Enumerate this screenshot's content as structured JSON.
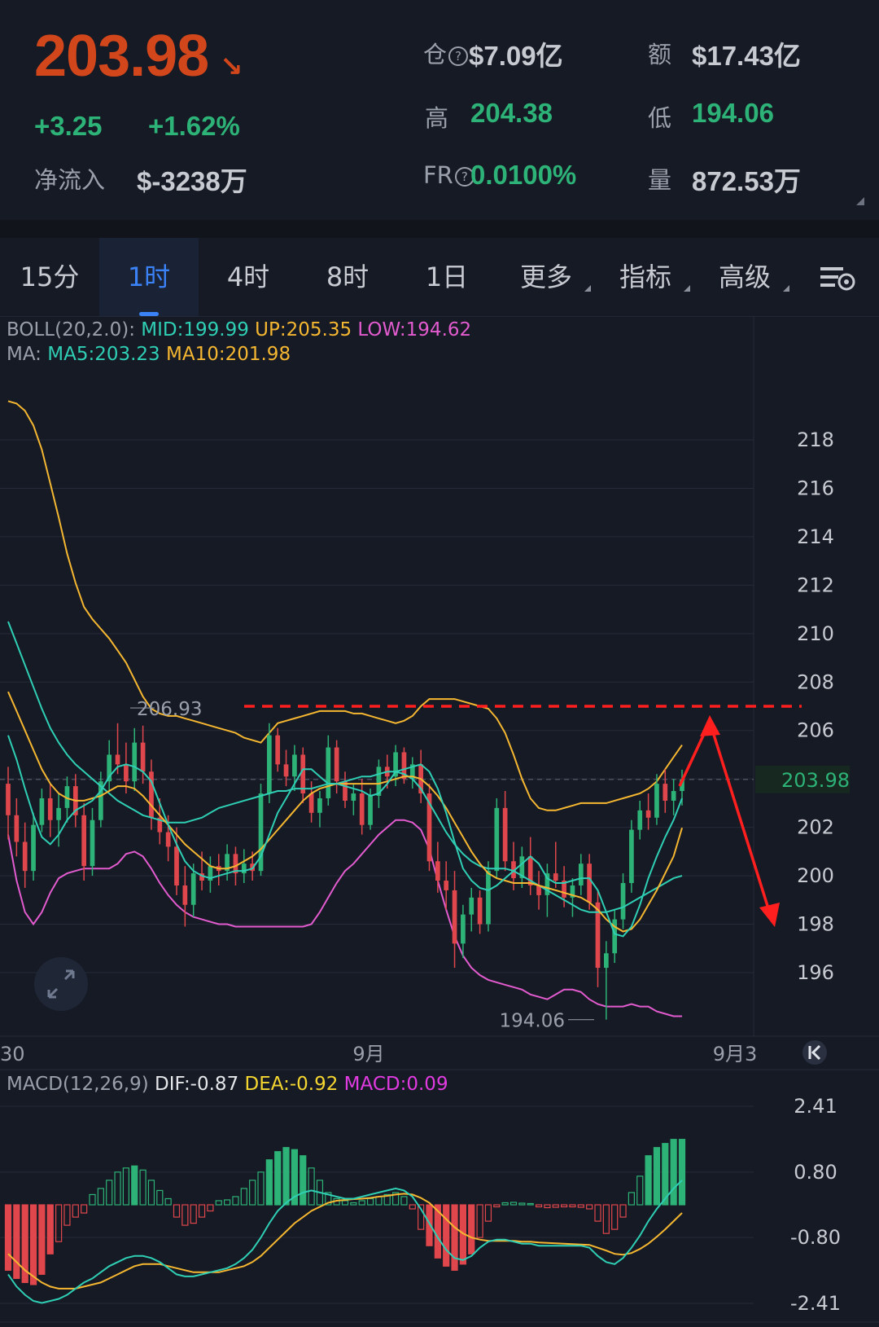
{
  "header": {
    "price": "203.98",
    "price_arrow": "↘",
    "change_abs": "+3.25",
    "change_pct": "+1.62%",
    "netflow_label": "净流入",
    "netflow_value": "$-3238万",
    "oi_label": "仓",
    "oi_value": "$7.09亿",
    "high_label": "高",
    "high_value": "204.38",
    "fr_label": "FR",
    "fr_value": "0.0100%",
    "turnover_label": "额",
    "turnover_value": "$17.43亿",
    "low_label": "低",
    "low_value": "194.06",
    "volume_label": "量",
    "volume_value": "872.53万"
  },
  "tabs": [
    {
      "label": "15分"
    },
    {
      "label": "1时"
    },
    {
      "label": "4时"
    },
    {
      "label": "8时"
    },
    {
      "label": "1日"
    },
    {
      "label": "更多"
    },
    {
      "label": "指标"
    },
    {
      "label": "高级"
    }
  ],
  "active_tab": "1时",
  "indicators": {
    "boll_prefix": "BOLL(20,2.0): ",
    "boll_mid": "MID:199.99",
    "boll_up": "UP:205.35",
    "boll_low": "LOW:194.62",
    "ma_prefix": "MA: ",
    "ma5": "MA5:203.23",
    "ma10": "MA10:201.98",
    "macd_prefix": "MACD(12,26,9) ",
    "dif": "DIF:-0.87",
    "dea": "DEA:-0.92",
    "macd": "MACD:0.09"
  },
  "colors": {
    "up": "#2db277",
    "down": "#e0474c",
    "mid": "#2fcfb5",
    "upper": "#f5b731",
    "lower": "#e25bcf",
    "price": "#d2461b",
    "annotation": "#ff1f1f"
  },
  "chart_data": [
    {
      "type": "candlestick",
      "title": "",
      "x_labels": [
        "30",
        "9月",
        "9月3"
      ],
      "y_ticks": [
        218,
        216,
        214,
        212,
        210,
        208,
        206,
        204,
        202,
        200,
        198,
        196
      ],
      "ylim": [
        194.06,
        220.5
      ],
      "current_price_label": "203.98",
      "high_annotation": "206.93",
      "low_annotation": "194.06",
      "ohlc": [
        [
          203.8,
          204.5,
          201.5,
          202.5
        ],
        [
          202.5,
          203.2,
          200.8,
          201.4
        ],
        [
          201.4,
          202.2,
          199.5,
          200.2
        ],
        [
          200.2,
          202.6,
          199.8,
          202.1
        ],
        [
          202.1,
          203.6,
          201.8,
          203.2
        ],
        [
          203.2,
          203.8,
          201.6,
          202.3
        ],
        [
          202.3,
          203.4,
          201.2,
          202.8
        ],
        [
          202.8,
          204.1,
          202.2,
          203.7
        ],
        [
          203.7,
          204.2,
          202.0,
          202.5
        ],
        [
          202.5,
          203.0,
          199.8,
          200.4
        ],
        [
          200.4,
          202.8,
          200.0,
          202.3
        ],
        [
          202.3,
          204.3,
          202.0,
          203.9
        ],
        [
          203.9,
          205.6,
          203.5,
          205.0
        ],
        [
          205.0,
          206.3,
          204.2,
          204.6
        ],
        [
          204.6,
          205.5,
          203.4,
          203.9
        ],
        [
          203.9,
          206.1,
          203.5,
          205.5
        ],
        [
          205.5,
          206.2,
          203.8,
          204.3
        ],
        [
          204.3,
          204.8,
          201.9,
          202.4
        ],
        [
          202.4,
          203.2,
          201.3,
          201.8
        ],
        [
          201.8,
          202.5,
          200.6,
          201.2
        ],
        [
          201.2,
          202.0,
          199.2,
          199.6
        ],
        [
          199.6,
          200.4,
          197.9,
          198.8
        ],
        [
          198.8,
          200.5,
          198.3,
          200.1
        ],
        [
          200.1,
          201.0,
          199.4,
          199.8
        ],
        [
          199.8,
          200.8,
          199.3,
          200.4
        ],
        [
          200.4,
          200.9,
          199.6,
          200.2
        ],
        [
          200.2,
          201.3,
          199.8,
          200.9
        ],
        [
          200.9,
          201.2,
          199.6,
          200.1
        ],
        [
          200.1,
          201.1,
          199.7,
          200.5
        ],
        [
          200.5,
          201.0,
          199.8,
          200.2
        ],
        [
          200.2,
          203.8,
          200.0,
          203.4
        ],
        [
          203.4,
          206.3,
          203.0,
          205.8
        ],
        [
          205.8,
          206.1,
          204.3,
          204.6
        ],
        [
          204.6,
          205.2,
          203.7,
          204.1
        ],
        [
          204.1,
          205.4,
          203.5,
          205.0
        ],
        [
          205.0,
          205.3,
          203.0,
          203.4
        ],
        [
          203.4,
          203.9,
          202.2,
          202.6
        ],
        [
          202.6,
          203.5,
          202.0,
          203.2
        ],
        [
          203.2,
          205.8,
          202.9,
          205.3
        ],
        [
          205.3,
          205.6,
          203.4,
          203.9
        ],
        [
          203.9,
          204.3,
          202.8,
          203.1
        ],
        [
          203.1,
          203.8,
          202.5,
          203.4
        ],
        [
          203.4,
          204.0,
          201.7,
          202.1
        ],
        [
          202.1,
          203.6,
          201.9,
          203.3
        ],
        [
          203.3,
          204.8,
          202.8,
          204.5
        ],
        [
          204.5,
          205.0,
          203.6,
          204.1
        ],
        [
          204.1,
          205.4,
          203.7,
          205.1
        ],
        [
          205.1,
          205.3,
          203.8,
          204.0
        ],
        [
          204.0,
          204.9,
          203.6,
          204.6
        ],
        [
          204.6,
          205.2,
          203.0,
          203.4
        ],
        [
          203.4,
          203.8,
          200.2,
          200.6
        ],
        [
          200.6,
          201.4,
          199.3,
          199.8
        ],
        [
          199.8,
          200.6,
          198.6,
          199.4
        ],
        [
          199.4,
          200.2,
          196.2,
          197.2
        ],
        [
          197.2,
          198.8,
          196.6,
          198.4
        ],
        [
          198.4,
          199.5,
          197.7,
          199.1
        ],
        [
          199.1,
          199.4,
          197.6,
          198.0
        ],
        [
          198.0,
          200.6,
          197.7,
          200.2
        ],
        [
          200.2,
          203.2,
          199.9,
          202.8
        ],
        [
          202.8,
          203.5,
          200.2,
          200.6
        ],
        [
          200.6,
          201.4,
          199.4,
          199.9
        ],
        [
          199.9,
          201.2,
          199.5,
          200.8
        ],
        [
          200.8,
          201.6,
          199.2,
          199.6
        ],
        [
          199.6,
          200.2,
          198.6,
          199.2
        ],
        [
          199.2,
          200.5,
          198.3,
          200.1
        ],
        [
          200.1,
          201.4,
          199.5,
          199.8
        ],
        [
          199.8,
          200.4,
          198.7,
          199.1
        ],
        [
          199.1,
          199.9,
          198.3,
          199.6
        ],
        [
          199.6,
          200.9,
          199.2,
          200.5
        ],
        [
          200.5,
          200.9,
          198.6,
          198.9
        ],
        [
          198.9,
          199.4,
          195.4,
          196.2
        ],
        [
          196.2,
          197.3,
          194.06,
          196.8
        ],
        [
          196.8,
          198.6,
          196.4,
          198.2
        ],
        [
          198.2,
          200.1,
          197.8,
          199.7
        ],
        [
          199.7,
          202.3,
          199.3,
          201.9
        ],
        [
          201.9,
          203.1,
          201.5,
          202.7
        ],
        [
          202.7,
          203.4,
          201.9,
          202.4
        ],
        [
          202.4,
          204.2,
          202.1,
          203.8
        ],
        [
          203.8,
          204.4,
          202.6,
          203.1
        ],
        [
          203.1,
          204.0,
          202.5,
          203.5
        ],
        [
          203.5,
          204.38,
          202.9,
          203.98
        ]
      ],
      "boll_upper": [
        219.6,
        219.5,
        219.2,
        218.6,
        217.6,
        216.2,
        214.8,
        213.3,
        212.1,
        211.1,
        210.6,
        210.2,
        209.8,
        209.3,
        208.8,
        208.1,
        207.4,
        206.9,
        206.7,
        206.6,
        206.6,
        206.5,
        206.4,
        206.3,
        206.2,
        206.1,
        206.0,
        205.9,
        205.7,
        205.6,
        205.5,
        205.9,
        206.3,
        206.4,
        206.5,
        206.6,
        206.7,
        206.8,
        206.8,
        206.8,
        206.8,
        206.7,
        206.7,
        206.6,
        206.5,
        206.4,
        206.3,
        206.4,
        206.6,
        207.0,
        207.3,
        207.3,
        207.3,
        207.3,
        207.2,
        207.1,
        207.0,
        206.9,
        206.5,
        205.9,
        205.0,
        204.0,
        203.2,
        202.8,
        202.7,
        202.7,
        202.8,
        202.9,
        203.0,
        203.0,
        203.0,
        203.0,
        203.1,
        203.2,
        203.3,
        203.4,
        203.6,
        203.9,
        204.4,
        204.9,
        205.4
      ],
      "boll_mid": [
        210.5,
        209.6,
        208.7,
        207.8,
        206.9,
        206.1,
        205.5,
        205.0,
        204.6,
        204.3,
        204.0,
        203.7,
        203.4,
        203.1,
        202.9,
        202.7,
        202.5,
        202.4,
        202.3,
        202.2,
        202.2,
        202.2,
        202.3,
        202.4,
        202.6,
        202.8,
        202.9,
        203.0,
        203.1,
        203.2,
        203.3,
        203.4,
        203.5,
        203.5,
        203.6,
        203.6,
        203.6,
        203.7,
        203.8,
        203.8,
        203.9,
        204.0,
        204.1,
        204.1,
        204.2,
        204.3,
        204.3,
        204.2,
        204.0,
        203.6,
        203.0,
        202.4,
        201.8,
        201.3,
        200.9,
        200.6,
        200.4,
        200.3,
        200.3,
        200.3,
        200.2,
        200.0,
        199.8,
        199.6,
        199.4,
        199.2,
        199.0,
        198.8,
        198.6,
        198.5,
        198.5,
        198.5,
        198.6,
        198.7,
        198.9,
        199.1,
        199.3,
        199.5,
        199.7,
        199.9,
        200.0
      ],
      "boll_lower": [
        201.7,
        199.8,
        198.5,
        198.0,
        198.5,
        199.3,
        199.9,
        200.1,
        200.2,
        200.3,
        200.3,
        200.3,
        200.3,
        200.5,
        200.9,
        201.0,
        200.8,
        200.3,
        199.7,
        199.2,
        198.8,
        198.5,
        198.3,
        198.2,
        198.1,
        198.0,
        198.0,
        197.9,
        197.9,
        197.9,
        197.9,
        197.9,
        197.9,
        197.9,
        197.9,
        197.9,
        198.0,
        198.5,
        199.1,
        199.7,
        200.2,
        200.5,
        200.9,
        201.3,
        201.7,
        202.0,
        202.3,
        202.3,
        202.2,
        201.9,
        201.1,
        199.8,
        198.6,
        197.5,
        196.7,
        196.2,
        195.9,
        195.7,
        195.6,
        195.5,
        195.4,
        195.3,
        195.1,
        195.0,
        194.9,
        195.1,
        195.3,
        195.3,
        195.2,
        194.9,
        194.7,
        194.6,
        194.6,
        194.6,
        194.7,
        194.6,
        194.6,
        194.4,
        194.3,
        194.2,
        194.2
      ],
      "ma5": [
        205.8,
        204.8,
        203.6,
        202.5,
        201.6,
        201.3,
        201.7,
        202.3,
        202.7,
        202.9,
        203.1,
        203.5,
        204.1,
        204.5,
        204.6,
        204.5,
        204.3,
        203.9,
        203.0,
        202.1,
        201.3,
        200.6,
        200.2,
        200.0,
        199.9,
        200.0,
        200.1,
        200.2,
        200.2,
        200.3,
        200.8,
        201.7,
        202.6,
        203.2,
        203.8,
        204.4,
        204.4,
        204.1,
        203.8,
        203.8,
        203.7,
        203.6,
        203.5,
        203.3,
        203.4,
        203.8,
        204.3,
        204.4,
        204.5,
        204.6,
        204.3,
        203.6,
        202.6,
        201.4,
        200.3,
        199.8,
        199.5,
        199.4,
        199.6,
        199.9,
        200.2,
        200.5,
        200.8,
        200.5,
        199.9,
        199.7,
        199.7,
        199.8,
        199.9,
        199.9,
        199.4,
        198.5,
        197.6,
        197.5,
        197.9,
        198.8,
        199.9,
        200.8,
        201.6,
        202.3,
        203.2
      ],
      "ma10": [
        207.6,
        206.8,
        206.0,
        205.2,
        204.4,
        203.8,
        203.4,
        203.2,
        203.1,
        203.1,
        203.2,
        203.3,
        203.5,
        203.7,
        203.7,
        203.6,
        203.3,
        202.9,
        202.5,
        202.1,
        201.7,
        201.3,
        201.0,
        200.7,
        200.4,
        200.3,
        200.3,
        200.4,
        200.6,
        200.8,
        201.1,
        201.5,
        201.9,
        202.3,
        202.7,
        203.1,
        203.4,
        203.6,
        203.7,
        203.8,
        203.8,
        203.8,
        203.8,
        203.8,
        203.8,
        203.9,
        204.0,
        204.1,
        204.1,
        204.0,
        203.7,
        203.3,
        202.8,
        202.2,
        201.6,
        201.0,
        200.5,
        200.1,
        199.9,
        199.8,
        199.7,
        199.7,
        199.7,
        199.6,
        199.5,
        199.4,
        199.3,
        199.2,
        199.1,
        198.9,
        198.6,
        198.2,
        197.9,
        197.7,
        197.8,
        198.2,
        198.8,
        199.4,
        200.1,
        200.8,
        201.98
      ]
    },
    {
      "type": "macd",
      "y_ticks": [
        2.41,
        0.8,
        -0.8,
        -2.41
      ],
      "ylim": [
        -2.41,
        2.41
      ],
      "dif": [
        -1.7,
        -2.0,
        -2.2,
        -2.35,
        -2.4,
        -2.35,
        -2.3,
        -2.2,
        -2.05,
        -1.9,
        -1.8,
        -1.65,
        -1.5,
        -1.4,
        -1.3,
        -1.25,
        -1.25,
        -1.3,
        -1.4,
        -1.55,
        -1.7,
        -1.75,
        -1.75,
        -1.7,
        -1.65,
        -1.6,
        -1.55,
        -1.45,
        -1.3,
        -1.1,
        -0.8,
        -0.45,
        -0.15,
        0.05,
        0.2,
        0.3,
        0.35,
        0.3,
        0.25,
        0.2,
        0.15,
        0.15,
        0.2,
        0.25,
        0.3,
        0.35,
        0.4,
        0.35,
        0.2,
        -0.1,
        -0.45,
        -0.8,
        -1.1,
        -1.3,
        -1.35,
        -1.25,
        -1.05,
        -0.9,
        -0.85,
        -0.85,
        -0.9,
        -0.95,
        -0.95,
        -1.0,
        -1.0,
        -1.0,
        -1.0,
        -1.0,
        -1.0,
        -1.05,
        -1.25,
        -1.4,
        -1.45,
        -1.3,
        -1.05,
        -0.75,
        -0.4,
        -0.1,
        0.15,
        0.4,
        0.6
      ],
      "dea": [
        -1.2,
        -1.4,
        -1.6,
        -1.75,
        -1.9,
        -2.0,
        -2.05,
        -2.05,
        -2.05,
        -2.0,
        -1.95,
        -1.9,
        -1.8,
        -1.7,
        -1.6,
        -1.5,
        -1.45,
        -1.45,
        -1.45,
        -1.5,
        -1.55,
        -1.6,
        -1.65,
        -1.65,
        -1.65,
        -1.65,
        -1.6,
        -1.55,
        -1.5,
        -1.4,
        -1.25,
        -1.05,
        -0.85,
        -0.65,
        -0.45,
        -0.3,
        -0.15,
        -0.05,
        0.05,
        0.1,
        0.12,
        0.14,
        0.15,
        0.17,
        0.2,
        0.22,
        0.25,
        0.27,
        0.25,
        0.17,
        0.05,
        -0.15,
        -0.35,
        -0.55,
        -0.7,
        -0.8,
        -0.85,
        -0.88,
        -0.88,
        -0.88,
        -0.88,
        -0.9,
        -0.9,
        -0.92,
        -0.93,
        -0.94,
        -0.95,
        -0.96,
        -0.97,
        -0.98,
        -1.05,
        -1.12,
        -1.2,
        -1.22,
        -1.18,
        -1.08,
        -0.95,
        -0.78,
        -0.6,
        -0.4,
        -0.2
      ],
      "hist": [
        -1.6,
        -1.8,
        -1.9,
        -1.95,
        -1.7,
        -1.2,
        -0.9,
        -0.5,
        -0.3,
        -0.2,
        0.25,
        0.4,
        0.6,
        0.8,
        0.9,
        0.95,
        0.85,
        0.6,
        0.35,
        0.15,
        -0.3,
        -0.5,
        -0.45,
        -0.3,
        -0.15,
        0.1,
        0.12,
        0.2,
        0.4,
        0.6,
        0.8,
        1.1,
        1.3,
        1.4,
        1.35,
        1.2,
        0.9,
        0.6,
        0.3,
        0.15,
        0.1,
        0.05,
        0.1,
        0.15,
        0.2,
        0.25,
        0.3,
        0.2,
        -0.1,
        -0.6,
        -1.0,
        -1.3,
        -1.5,
        -1.6,
        -1.45,
        -1.2,
        -0.8,
        -0.4,
        -0.05,
        0.05,
        0.06,
        0.04,
        0.03,
        -0.05,
        -0.07,
        -0.06,
        -0.05,
        -0.05,
        -0.06,
        -0.1,
        -0.4,
        -0.7,
        -0.6,
        -0.3,
        0.3,
        0.7,
        1.2,
        1.4,
        1.5,
        1.6,
        1.6
      ]
    }
  ]
}
